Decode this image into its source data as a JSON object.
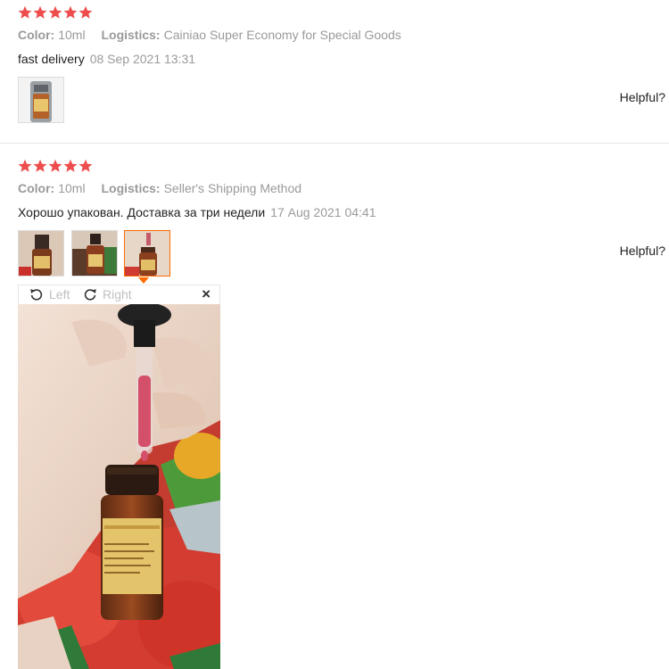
{
  "colors": {
    "star": "#ee4d4d",
    "accent": "#ff6a00",
    "muted_text": "#9a9a9a"
  },
  "reviews": [
    {
      "rating": 5,
      "color_label": "Color:",
      "color_value": "10ml",
      "logistics_label": "Logistics:",
      "logistics_value": "Cainiao Super Economy for Special Goods",
      "text": "fast delivery",
      "date": "08 Sep 2021 13:31",
      "helpful": "Helpful?"
    },
    {
      "rating": 5,
      "color_label": "Color:",
      "color_value": "10ml",
      "logistics_label": "Logistics:",
      "logistics_value": "Seller's Shipping Method",
      "text": "Хорошо упакован. Доставка за три недели",
      "date": "17 Aug 2021 04:41",
      "helpful": "Helpful?"
    }
  ],
  "viewer": {
    "rotate_left": "Left",
    "rotate_right": "Right",
    "close_glyph": "×"
  }
}
